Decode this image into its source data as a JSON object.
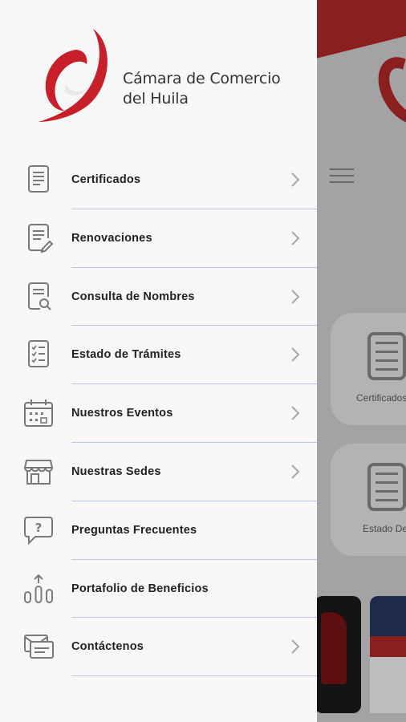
{
  "brand": {
    "line1": "Cámara de Comercio",
    "line2": "del Huila",
    "color": "#c8202b"
  },
  "menu": {
    "items": [
      {
        "label": "Certificados",
        "icon": "document-icon",
        "chevron": true
      },
      {
        "label": "Renovaciones",
        "icon": "document-edit-icon",
        "chevron": true
      },
      {
        "label": "Consulta de Nombres",
        "icon": "document-search-icon",
        "chevron": true
      },
      {
        "label": "Estado de Trámites",
        "icon": "checklist-icon",
        "chevron": true
      },
      {
        "label": "Nuestros Eventos",
        "icon": "calendar-icon",
        "chevron": true
      },
      {
        "label": "Nuestras Sedes",
        "icon": "store-icon",
        "chevron": true
      },
      {
        "label": "Preguntas Frecuentes",
        "icon": "question-chat-icon",
        "chevron": false
      },
      {
        "label": "Portafolio de Beneficios",
        "icon": "growth-chart-icon",
        "chevron": false
      },
      {
        "label": "Contáctenos",
        "icon": "mail-icon",
        "chevron": true
      }
    ]
  },
  "background": {
    "cards": [
      {
        "label": "Certificados"
      },
      {
        "label": "Estado De Trámites"
      }
    ]
  }
}
